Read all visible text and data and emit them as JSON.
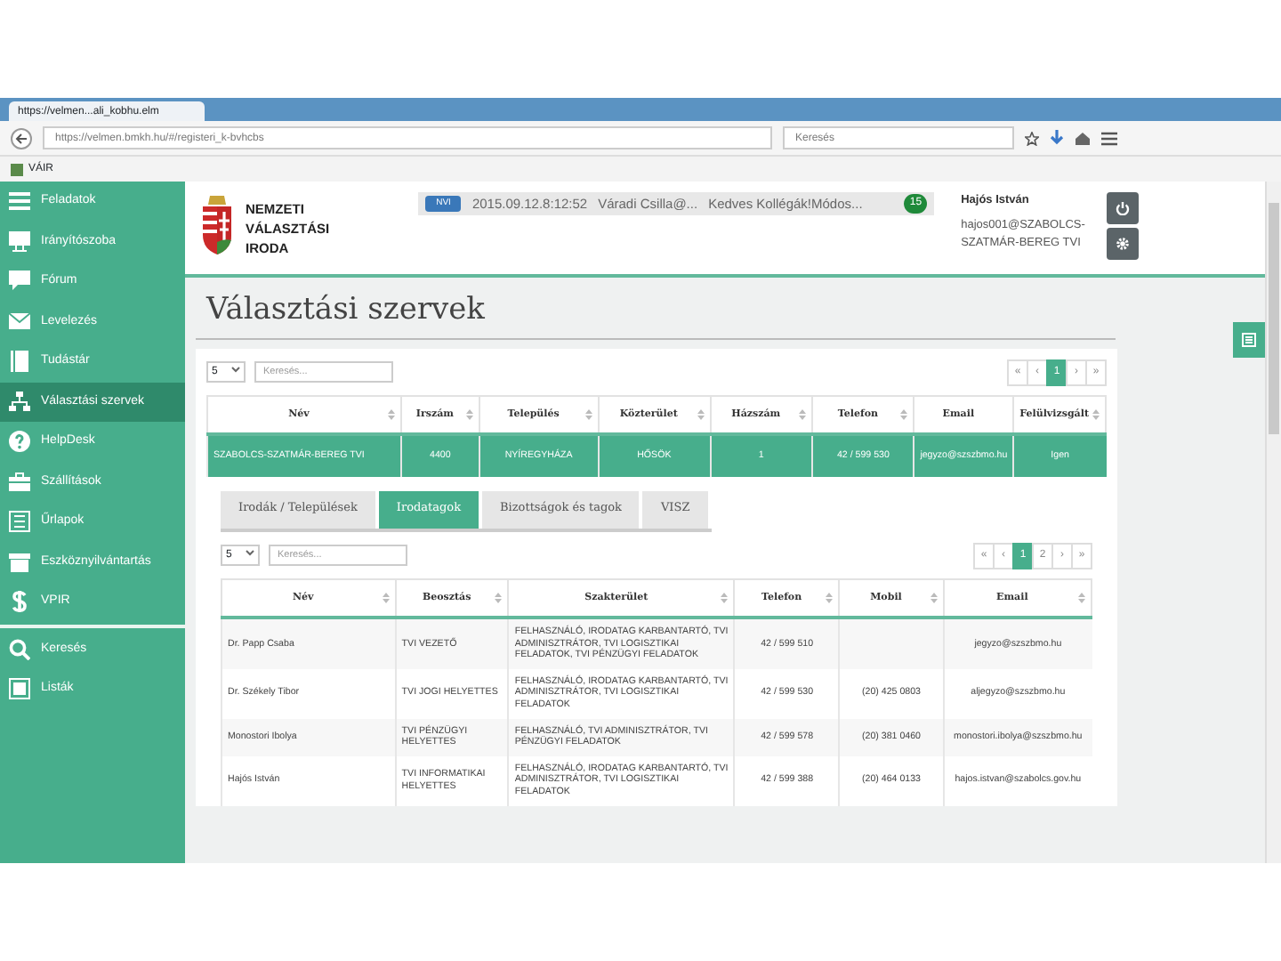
{
  "browser": {
    "tab_title": "https://velmen...ali_kobhu.elm",
    "address": "https://velmen.bmkh.hu/#/registeri_k-bvhcbs",
    "search_placeholder": "Keresés",
    "bookmark": "VÁIR"
  },
  "sidebar": {
    "items": [
      {
        "label": "Feladatok",
        "selected": false
      },
      {
        "label": "Irányítószoba",
        "selected": false
      },
      {
        "label": "Fórum",
        "selected": false
      },
      {
        "label": "Levelezés",
        "selected": false
      },
      {
        "label": "Tudástár",
        "selected": false
      },
      {
        "label": "Választási szervek",
        "selected": true
      },
      {
        "label": "HelpDesk",
        "selected": false
      },
      {
        "label": "Szállítások",
        "selected": false
      },
      {
        "label": "Űrlapok",
        "selected": false
      },
      {
        "label": "Eszköznyilvántartás",
        "selected": false
      },
      {
        "label": "VPIR",
        "selected": false
      }
    ],
    "bottom_items": [
      {
        "label": "Keresés",
        "selected": false
      },
      {
        "label": "Listák",
        "selected": false
      }
    ]
  },
  "header": {
    "org_name": [
      "NEMZETI",
      "VÁLASZTÁSI",
      "IRODA"
    ],
    "notice": {
      "badge": "NVI",
      "time": "2015.09.12.8:12:52",
      "sender": "Váradi Csilla@...",
      "message": "Kedves Kollégák!Módos...",
      "count": "15"
    },
    "user": {
      "name": "Hajós István",
      "account": "hajos001@SZABOLCS-SZATMÁR-BEREG TVI"
    }
  },
  "page_title": "Választási szervek",
  "offices": {
    "page_length": "5",
    "search_placeholder": "Keresés...",
    "pagination": [
      {
        "label": "«",
        "selected": false
      },
      {
        "label": "‹",
        "selected": false
      },
      {
        "label": "1",
        "selected": true
      },
      {
        "label": "›",
        "selected": false
      },
      {
        "label": "»",
        "selected": false
      }
    ],
    "columns": [
      {
        "label": "Név",
        "sortable": true
      },
      {
        "label": "Irszám",
        "sortable": true
      },
      {
        "label": "Település",
        "sortable": true
      },
      {
        "label": "Közterület",
        "sortable": true
      },
      {
        "label": "Házszám",
        "sortable": true
      },
      {
        "label": "Telefon",
        "sortable": true
      },
      {
        "label": "Email",
        "sortable": false
      },
      {
        "label": "Felülvizsgált",
        "sortable": true
      }
    ],
    "rows": [
      {
        "selected": true,
        "cells": [
          "SZABOLCS-SZATMÁR-BEREG TVI",
          "4400",
          "NYÍREGYHÁZA",
          "HŐSÖK",
          "1",
          "42 / 599 530",
          "jegyzo@szszbmo.hu",
          "Igen"
        ]
      }
    ]
  },
  "tabs": [
    {
      "label": "Irodák / Települések",
      "selected": false
    },
    {
      "label": "Irodatagok",
      "selected": true
    },
    {
      "label": "Bizottságok és tagok",
      "selected": false
    },
    {
      "label": "VISZ",
      "selected": false
    }
  ],
  "members": {
    "page_length": "5",
    "search_placeholder": "Keresés...",
    "pagination": [
      {
        "label": "«",
        "selected": false
      },
      {
        "label": "‹",
        "selected": false
      },
      {
        "label": "1",
        "selected": true
      },
      {
        "label": "2",
        "selected": false
      },
      {
        "label": "›",
        "selected": false
      },
      {
        "label": "»",
        "selected": false
      }
    ],
    "columns": [
      {
        "label": "Név",
        "sortable": true
      },
      {
        "label": "Beosztás",
        "sortable": true
      },
      {
        "label": "Szakterület",
        "sortable": true
      },
      {
        "label": "Telefon",
        "sortable": true
      },
      {
        "label": "Mobil",
        "sortable": true
      },
      {
        "label": "Email",
        "sortable": true
      }
    ],
    "rows": [
      {
        "selected": false,
        "cells": [
          "Dr. Papp Csaba",
          "TVI VEZETŐ",
          "FELHASZNÁLÓ, IRODATAG KARBANTARTÓ, TVI ADMINISZTRÁTOR, TVI LOGISZTIKAI FELADATOK, TVI PÉNZÜGYI FELADATOK",
          "42 / 599 510",
          null,
          "jegyzo@szszbmo.hu"
        ]
      },
      {
        "selected": false,
        "cells": [
          "Dr. Székely Tibor",
          "TVI JOGI HELYETTES",
          "FELHASZNÁLÓ, IRODATAG KARBANTARTÓ, TVI ADMINISZTRÁTOR, TVI LOGISZTIKAI FELADATOK",
          "42 / 599 530",
          "(20) 425 0803",
          "aljegyzo@szszbmo.hu"
        ]
      },
      {
        "selected": false,
        "cells": [
          "Monostori Ibolya",
          "TVI PÉNZÜGYI HELYETTES",
          "FELHASZNÁLÓ, TVI ADMINISZTRÁTOR, TVI PÉNZÜGYI FELADATOK",
          "42 / 599 578",
          "(20) 381 0460",
          "monostori.ibolya@szszbmo.hu"
        ]
      },
      {
        "selected": false,
        "cells": [
          "Hajós István",
          "TVI INFORMATIKAI HELYETTES",
          "FELHASZNÁLÓ, IRODATAG KARBANTARTÓ, TVI ADMINISZTRÁTOR, TVI LOGISZTIKAI FELADATOK",
          "42 / 599 388",
          "(20) 464 0133",
          "hajos.istvan@szabolcs.gov.hu"
        ]
      }
    ]
  }
}
